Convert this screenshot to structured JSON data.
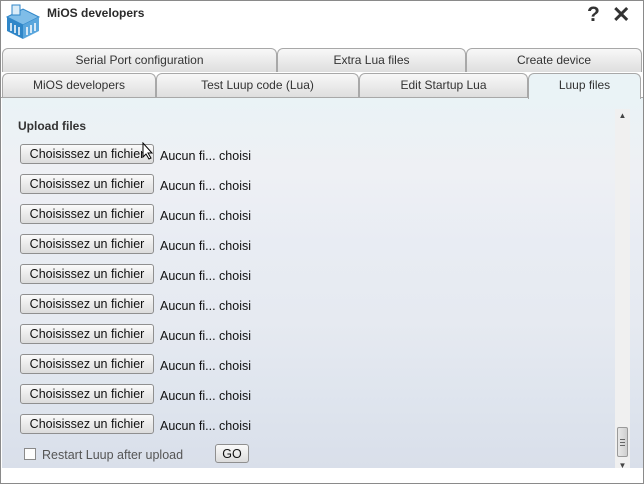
{
  "window": {
    "title": "MiOS developers",
    "help_glyph": "?",
    "close_glyph": "✕"
  },
  "tabs": {
    "row1": [
      {
        "label": "Serial Port configuration"
      },
      {
        "label": "Extra Lua files"
      },
      {
        "label": "Create device"
      }
    ],
    "row2": [
      {
        "label": "MiOS developers"
      },
      {
        "label": "Test Luup code (Lua)"
      },
      {
        "label": "Edit Startup Lua"
      },
      {
        "label": "Luup files",
        "active": true
      }
    ]
  },
  "main": {
    "section_title": "Upload files",
    "uploads": [
      {
        "button": "Choisissez un fichier",
        "status": "Aucun fi... choisi"
      },
      {
        "button": "Choisissez un fichier",
        "status": "Aucun fi... choisi"
      },
      {
        "button": "Choisissez un fichier",
        "status": "Aucun fi... choisi"
      },
      {
        "button": "Choisissez un fichier",
        "status": "Aucun fi... choisi"
      },
      {
        "button": "Choisissez un fichier",
        "status": "Aucun fi... choisi"
      },
      {
        "button": "Choisissez un fichier",
        "status": "Aucun fi... choisi"
      },
      {
        "button": "Choisissez un fichier",
        "status": "Aucun fi... choisi"
      },
      {
        "button": "Choisissez un fichier",
        "status": "Aucun fi... choisi"
      },
      {
        "button": "Choisissez un fichier",
        "status": "Aucun fi... choisi"
      },
      {
        "button": "Choisissez un fichier",
        "status": "Aucun fi... choisi"
      }
    ],
    "restart_label": "Restart Luup after upload",
    "restart_checked": false,
    "go_label": "GO"
  },
  "colors": {
    "active_tab": "#eaf3f6",
    "tab_border": "#a8a8a8",
    "logo_blue": "#2f86c8"
  }
}
